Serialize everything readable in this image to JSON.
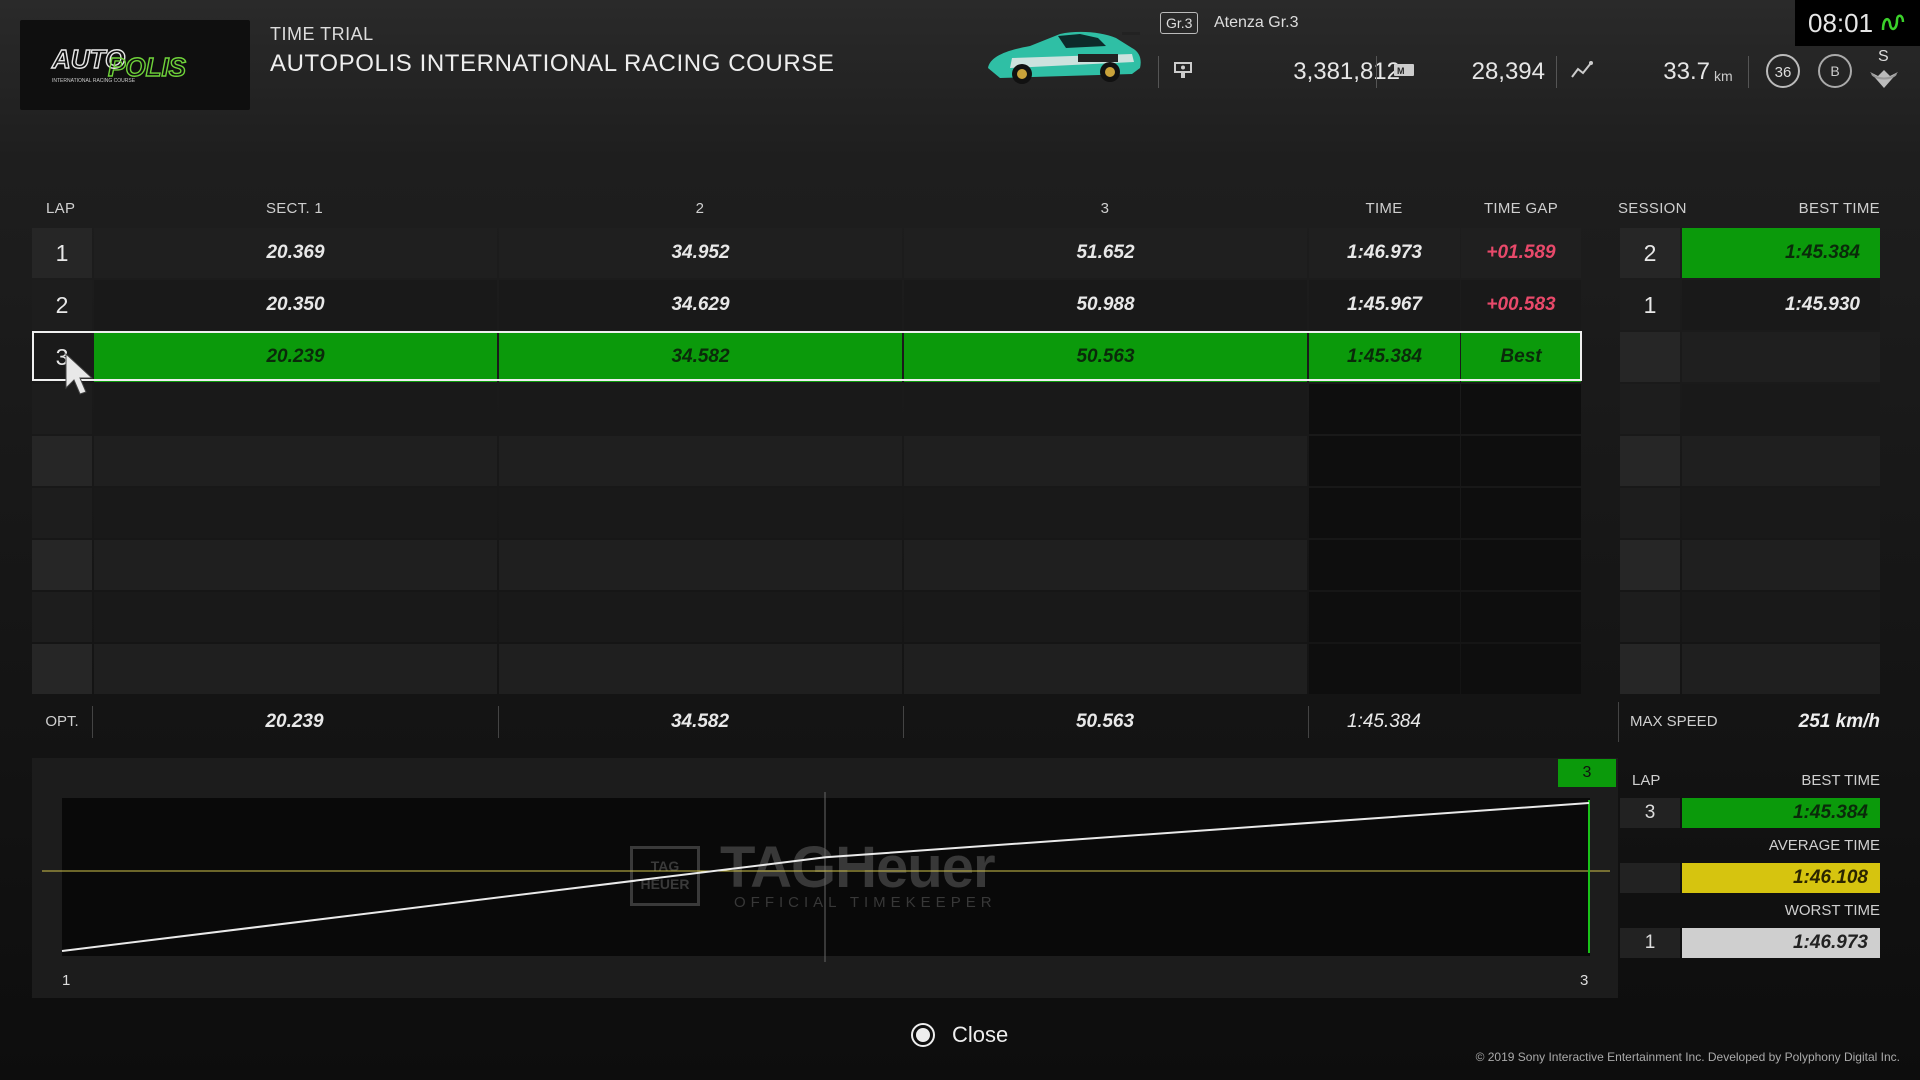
{
  "header": {
    "mode": "TIME TRIAL",
    "track": "AUTOPOLIS INTERNATIONAL RACING COURSE",
    "logo_text": "AUTOPOLIS",
    "logo_subtext": "INTERNATIONAL RACING COURSE",
    "car_class": "Gr.3",
    "car_name": "Atenza Gr.3",
    "credits": "3,381,812",
    "mileage_points": "28,394",
    "distance": "33.7",
    "distance_unit": "km",
    "level": "36",
    "driver_rating": "B",
    "sportsmanship_rating": "S",
    "clock": "08:01",
    "icons": [
      "credits-icon",
      "mileage-icon",
      "distance-icon",
      "network-icon"
    ]
  },
  "table": {
    "headers": {
      "lap": "LAP",
      "sect1": "SECT. 1",
      "sect2": "2",
      "sect3": "3",
      "time": "TIME",
      "gap": "TIME GAP",
      "session": "SESSION",
      "best_time": "BEST TIME"
    },
    "laps": [
      {
        "lap": "1",
        "s1": "20.369",
        "s2": "34.952",
        "s3": "51.652",
        "time": "1:46.973",
        "gap": "+01.589"
      },
      {
        "lap": "2",
        "s1": "20.350",
        "s2": "34.629",
        "s3": "50.988",
        "time": "1:45.967",
        "gap": "+00.583"
      },
      {
        "lap": "3",
        "s1": "20.239",
        "s2": "34.582",
        "s3": "50.563",
        "time": "1:45.384",
        "gap": "Best"
      }
    ],
    "sessions": [
      {
        "session": "2",
        "best": "1:45.384"
      },
      {
        "session": "1",
        "best": "1:45.930"
      }
    ],
    "optimal": {
      "label": "OPT.",
      "s1": "20.239",
      "s2": "34.582",
      "s3": "50.563",
      "time": "1:45.384"
    },
    "max_speed": {
      "label": "MAX SPEED",
      "value": "251 km/h"
    }
  },
  "graph": {
    "x_start": "1",
    "x_end": "3",
    "marker": "3",
    "watermark": "TAGHeuer",
    "watermark_badge": "TAG HEUER",
    "watermark_sub": "OFFICIAL TIMEKEEPER"
  },
  "summary": {
    "lap_label": "LAP",
    "best_label": "BEST TIME",
    "best_lap": "3",
    "best_time": "1:45.384",
    "avg_label": "AVERAGE TIME",
    "avg_time": "1:46.108",
    "worst_label": "WORST TIME",
    "worst_lap": "1",
    "worst_time": "1:46.973"
  },
  "footer": {
    "close_label": "Close",
    "copyright": "© 2019 Sony Interactive Entertainment Inc. Developed by Polyphony Digital Inc."
  },
  "colors": {
    "best_green": "#0b9a0b",
    "gap_pink": "#e8496a",
    "average_yellow": "#d6c40f",
    "worst_gray": "#cfcfcf"
  }
}
